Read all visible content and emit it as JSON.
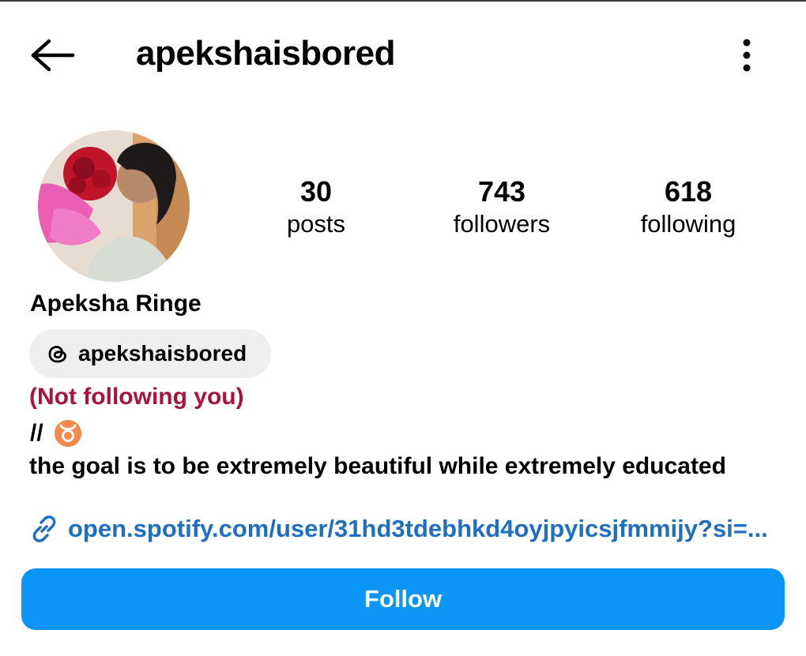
{
  "header": {
    "username": "apekshaisbored",
    "back_icon": "arrow-left-icon",
    "more_icon": "vertical-dots-icon"
  },
  "profile": {
    "avatar_alt": "profile-photo",
    "stats": [
      {
        "value": "30",
        "label": "posts"
      },
      {
        "value": "743",
        "label": "followers"
      },
      {
        "value": "618",
        "label": "following"
      }
    ],
    "full_name": "Apeksha Ringe",
    "threads_handle": "apekshaisbored",
    "relationship_status": "(Not following you)",
    "bio_prefix": "//",
    "bio_text": "the goal is to be extremely beautiful while extremely educated",
    "link": "open.spotify.com/user/31hd3tdebhkd4oyjpyicsjfmmijy?si=..."
  },
  "actions": {
    "follow_label": "Follow"
  },
  "colors": {
    "follow_button": "#0b95f6",
    "link": "#1f6fc1",
    "not_following": "#a5153f",
    "chip_bg": "#efeff0",
    "taurus_badge": "#f58a48"
  }
}
